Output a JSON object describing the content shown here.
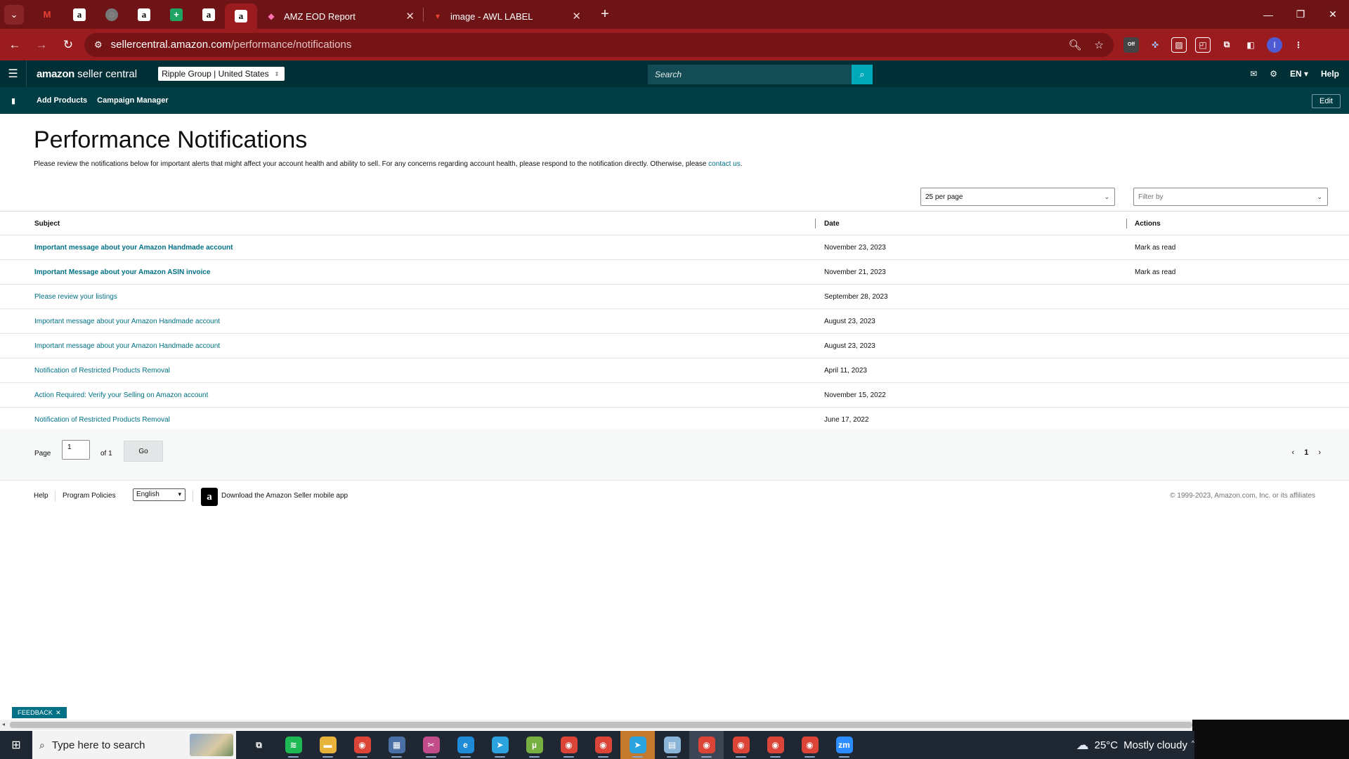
{
  "browser": {
    "tabs": {
      "pinned": [
        {
          "icon": "gmail-icon",
          "glyph": "M"
        },
        {
          "icon": "amazon-icon",
          "glyph": "a"
        },
        {
          "icon": "globe-icon",
          "glyph": "◌"
        },
        {
          "icon": "amazon-icon",
          "glyph": "a"
        },
        {
          "icon": "sheets-icon",
          "glyph": "+"
        },
        {
          "icon": "amazon-icon",
          "glyph": "a"
        },
        {
          "icon": "amazon-icon",
          "glyph": "a"
        }
      ],
      "full": [
        {
          "title": "AMZ EOD Report",
          "icon": "clickup-icon",
          "close": "✕"
        },
        {
          "title": "image - AWL LABEL",
          "icon": "gmail-icon",
          "close": "✕"
        }
      ],
      "new_tab": "+"
    },
    "window_controls": {
      "minimize": "—",
      "restore": "❐",
      "close": "✕"
    },
    "address": {
      "host": "sellercentral.amazon.com",
      "path": "/performance/notifications"
    },
    "extension_badge": "Off"
  },
  "seller_central": {
    "logo_amazon": "amazon",
    "logo_product": "seller central",
    "account": "Ripple Group | United States",
    "search_placeholder": "Search",
    "lang": "EN",
    "help": "Help",
    "subnav": [
      "Add Products",
      "Campaign Manager"
    ],
    "edit": "Edit"
  },
  "page": {
    "title": "Performance Notifications",
    "description": "Please review the notifications below for important alerts that might affect your account health and ability to sell. For any concerns regarding account health, please respond to the notification directly. Otherwise, please ",
    "contact_link": "contact us",
    "description_end": ".",
    "per_page": "25 per page",
    "filter_placeholder": "Filter by",
    "columns": {
      "subject": "Subject",
      "date": "Date",
      "actions": "Actions"
    },
    "rows": [
      {
        "subject": "Important message about your Amazon Handmade account",
        "date": "November 23, 2023",
        "action": "Mark as read"
      },
      {
        "subject": "Important Message about your Amazon ASIN invoice",
        "date": "November 21, 2023",
        "action": "Mark as read"
      },
      {
        "subject": "Please review your listings",
        "date": "September 28, 2023",
        "action": ""
      },
      {
        "subject": "Important message about your Amazon Handmade account",
        "date": "August 23, 2023",
        "action": ""
      },
      {
        "subject": "Important message about your Amazon Handmade account",
        "date": "August 23, 2023",
        "action": ""
      },
      {
        "subject": "Notification of Restricted Products Removal",
        "date": "April 11, 2023",
        "action": ""
      },
      {
        "subject": "Action Required: Verify your Selling on Amazon account",
        "date": "November 15, 2022",
        "action": ""
      },
      {
        "subject": "Notification of Restricted Products Removal",
        "date": "June 17, 2022",
        "action": ""
      }
    ],
    "pager": {
      "label": "Page",
      "value": "1",
      "of": "of 1",
      "go": "Go",
      "current": "1",
      "prev": "‹",
      "next": "›"
    }
  },
  "footer": {
    "help": "Help",
    "policies": "Program Policies",
    "language": "English",
    "app_link": "Download the Amazon Seller mobile app",
    "copyright": "© 1999-2023, Amazon.com, Inc. or its affiliates"
  },
  "feedback": "FEEDBACK",
  "taskbar": {
    "search_placeholder": "Type here to search",
    "weather_temp": "25°C",
    "weather_text": "Mostly cloudy",
    "apps": [
      {
        "name": "task-view",
        "glyph": "⧉",
        "bg": "transparent"
      },
      {
        "name": "spotify",
        "glyph": "≋",
        "bg": "#1db954"
      },
      {
        "name": "file-explorer",
        "glyph": "▬",
        "bg": "#e8b33a"
      },
      {
        "name": "chrome",
        "glyph": "◉",
        "bg": "#db4437"
      },
      {
        "name": "calculator",
        "glyph": "▦",
        "bg": "#4a6fa5"
      },
      {
        "name": "snipping",
        "glyph": "✂",
        "bg": "#c24b8a"
      },
      {
        "name": "edge",
        "glyph": "e",
        "bg": "#1f8ad6"
      },
      {
        "name": "telegram",
        "glyph": "➤",
        "bg": "#2aa3df"
      },
      {
        "name": "utorrent",
        "glyph": "µ",
        "bg": "#77b041"
      },
      {
        "name": "chrome-profile",
        "glyph": "◉",
        "bg": "#db4437"
      },
      {
        "name": "chrome-profile",
        "glyph": "◉",
        "bg": "#db4437"
      },
      {
        "name": "telegram",
        "glyph": "➤",
        "bg": "#2aa3df"
      },
      {
        "name": "notes",
        "glyph": "▤",
        "bg": "#8ab4d8"
      },
      {
        "name": "chrome-profile",
        "glyph": "◉",
        "bg": "#db4437"
      },
      {
        "name": "chrome-profile",
        "glyph": "◉",
        "bg": "#db4437"
      },
      {
        "name": "chrome-profile",
        "glyph": "◉",
        "bg": "#db4437"
      },
      {
        "name": "chrome-profile",
        "glyph": "◉",
        "bg": "#db4437"
      },
      {
        "name": "zoom",
        "glyph": "zm",
        "bg": "#2d8cff"
      }
    ]
  },
  "colors": {
    "link": "#007185",
    "header": "#002f36",
    "subnav": "#003d44",
    "tabstrip": "#6e1416",
    "toolbar": "#9b1c1f"
  }
}
